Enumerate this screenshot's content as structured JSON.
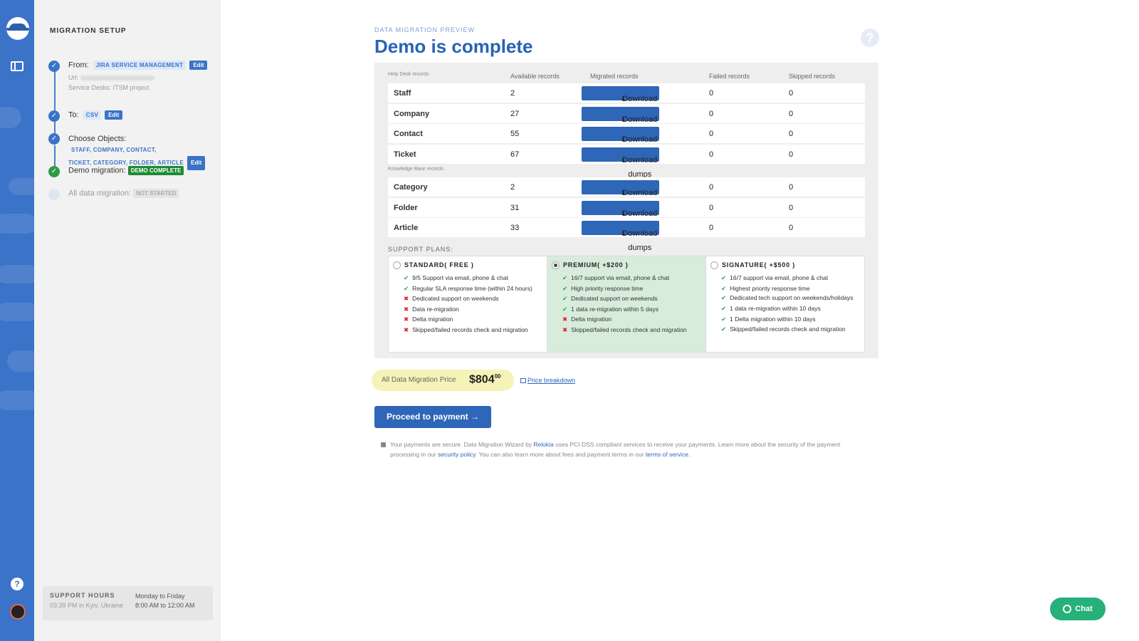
{
  "setup": {
    "title": "MIGRATION SETUP",
    "from": {
      "label": "From:",
      "value": "JIRA SERVICE MANAGEMENT",
      "edit": "Edit",
      "url_label": "Url:",
      "service_desks_label": "Service Desks:",
      "service_desks_value": "ITSM project"
    },
    "to": {
      "label": "To:",
      "value": "CSV",
      "edit": "Edit"
    },
    "objects": {
      "label": "Choose Objects:",
      "value1": "STAFF, COMPANY, CONTACT,",
      "value2": "TICKET, CATEGORY, FOLDER, ARTICLE",
      "edit": "Edit"
    },
    "demo": {
      "label": "Demo migration:",
      "status": "DEMO COMPLETE"
    },
    "all": {
      "label": "All data migration:",
      "status": "NOT STARTED"
    },
    "support": {
      "title": "SUPPORT HOURS",
      "local_time": "03:39 PM in Kyiv, Ukraine",
      "days": "Monday to Friday",
      "hours": "8:00 AM to 12:00 AM"
    }
  },
  "header": {
    "eyebrow": "DATA MIGRATION PREVIEW",
    "title": "Demo is complete",
    "help": "?"
  },
  "table": {
    "headers": {
      "group1": "Help Desk records",
      "available": "Available records",
      "migrated": "Migrated records",
      "failed": "Failed records",
      "skipped": "Skipped records"
    },
    "group2": "Knowledge Base records",
    "button": "Download dumps",
    "helpdesk": [
      {
        "name": "Staff",
        "available": "2",
        "failed": "0",
        "skipped": "0"
      },
      {
        "name": "Company",
        "available": "27",
        "failed": "0",
        "skipped": "0"
      },
      {
        "name": "Contact",
        "available": "55",
        "failed": "0",
        "skipped": "0"
      },
      {
        "name": "Ticket",
        "available": "67",
        "failed": "0",
        "skipped": "0"
      }
    ],
    "kb": [
      {
        "name": "Category",
        "available": "2",
        "failed": "0",
        "skipped": "0"
      },
      {
        "name": "Folder",
        "available": "31",
        "failed": "0",
        "skipped": "0"
      },
      {
        "name": "Article",
        "available": "33",
        "failed": "0",
        "skipped": "0"
      }
    ]
  },
  "plans": {
    "label": "SUPPORT PLANS:",
    "items": [
      {
        "name": "STANDARD( FREE )",
        "selected": false,
        "features": [
          {
            "ok": true,
            "text": "9/5 Support via email, phone & chat"
          },
          {
            "ok": true,
            "text": "Regular SLA response time (within 24 hours)"
          },
          {
            "ok": false,
            "text": "Dedicated support on weekends"
          },
          {
            "ok": false,
            "text": "Data re-migration"
          },
          {
            "ok": false,
            "text": "Delta migration"
          },
          {
            "ok": false,
            "text": "Skipped/failed records check and migration"
          }
        ]
      },
      {
        "name": "PREMIUM( +$200 )",
        "selected": true,
        "features": [
          {
            "ok": true,
            "text": "16/7 support via email, phone & chat"
          },
          {
            "ok": true,
            "text": "High priority response time"
          },
          {
            "ok": true,
            "text": "Dedicated support on weekends"
          },
          {
            "ok": true,
            "text": "1 data re-migration within 5 days"
          },
          {
            "ok": false,
            "text": "Delta migration"
          },
          {
            "ok": false,
            "text": "Skipped/failed records check and migration"
          }
        ]
      },
      {
        "name": "SIGNATURE( +$500 )",
        "selected": false,
        "features": [
          {
            "ok": true,
            "text": "16/7 support via email, phone & chat"
          },
          {
            "ok": true,
            "text": "Highest priority response time"
          },
          {
            "ok": true,
            "text": "Dedicated tech support on weekends/holidays"
          },
          {
            "ok": true,
            "text": "1 data re-migration within 10 days"
          },
          {
            "ok": true,
            "text": "1 Delta migration within 10 days"
          },
          {
            "ok": true,
            "text": "Skipped/failed records check and migration"
          }
        ]
      }
    ]
  },
  "price": {
    "label": "All Data Migration Price",
    "amount": "$804",
    "cents": "00",
    "breakdown": "Price breakdown"
  },
  "proceed": "Proceed to payment →",
  "secure": {
    "t1": "Your payments are secure. Data Migration Wizard by ",
    "brand": "Relokia",
    "t2": " uses PCI DSS compliant services to receive your payments. Learn more about the security of the payment",
    "t3": "processing in our ",
    "policy": "security policy",
    "t4": ". You can also learn more about fees and payment terms in our ",
    "tos": "terms of service",
    "t5": "."
  },
  "chat": "Chat",
  "colors": {
    "brand": "#3b73c8",
    "button": "#2e66b8",
    "success": "#1e8a34",
    "chat": "#26b07a",
    "price_bg": "#f6f3b8"
  }
}
